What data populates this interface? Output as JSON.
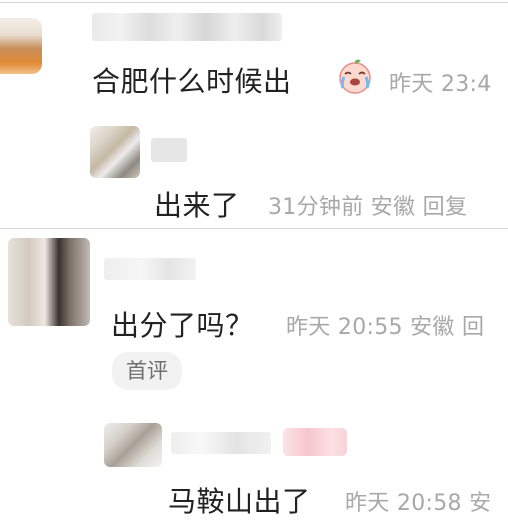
{
  "comment1": {
    "text": "合肥什么时候出",
    "emoji": "crying-face-emoji",
    "meta": "昨天 23:4"
  },
  "reply1": {
    "text": "出来了",
    "meta": "31分钟前  安徽  回复"
  },
  "comment2": {
    "text": "出分了吗？",
    "meta": "昨天 20:55 安徽  回",
    "badge": "首评"
  },
  "reply2": {
    "text": "马鞍山出了",
    "meta": "昨天 20:58 安"
  }
}
